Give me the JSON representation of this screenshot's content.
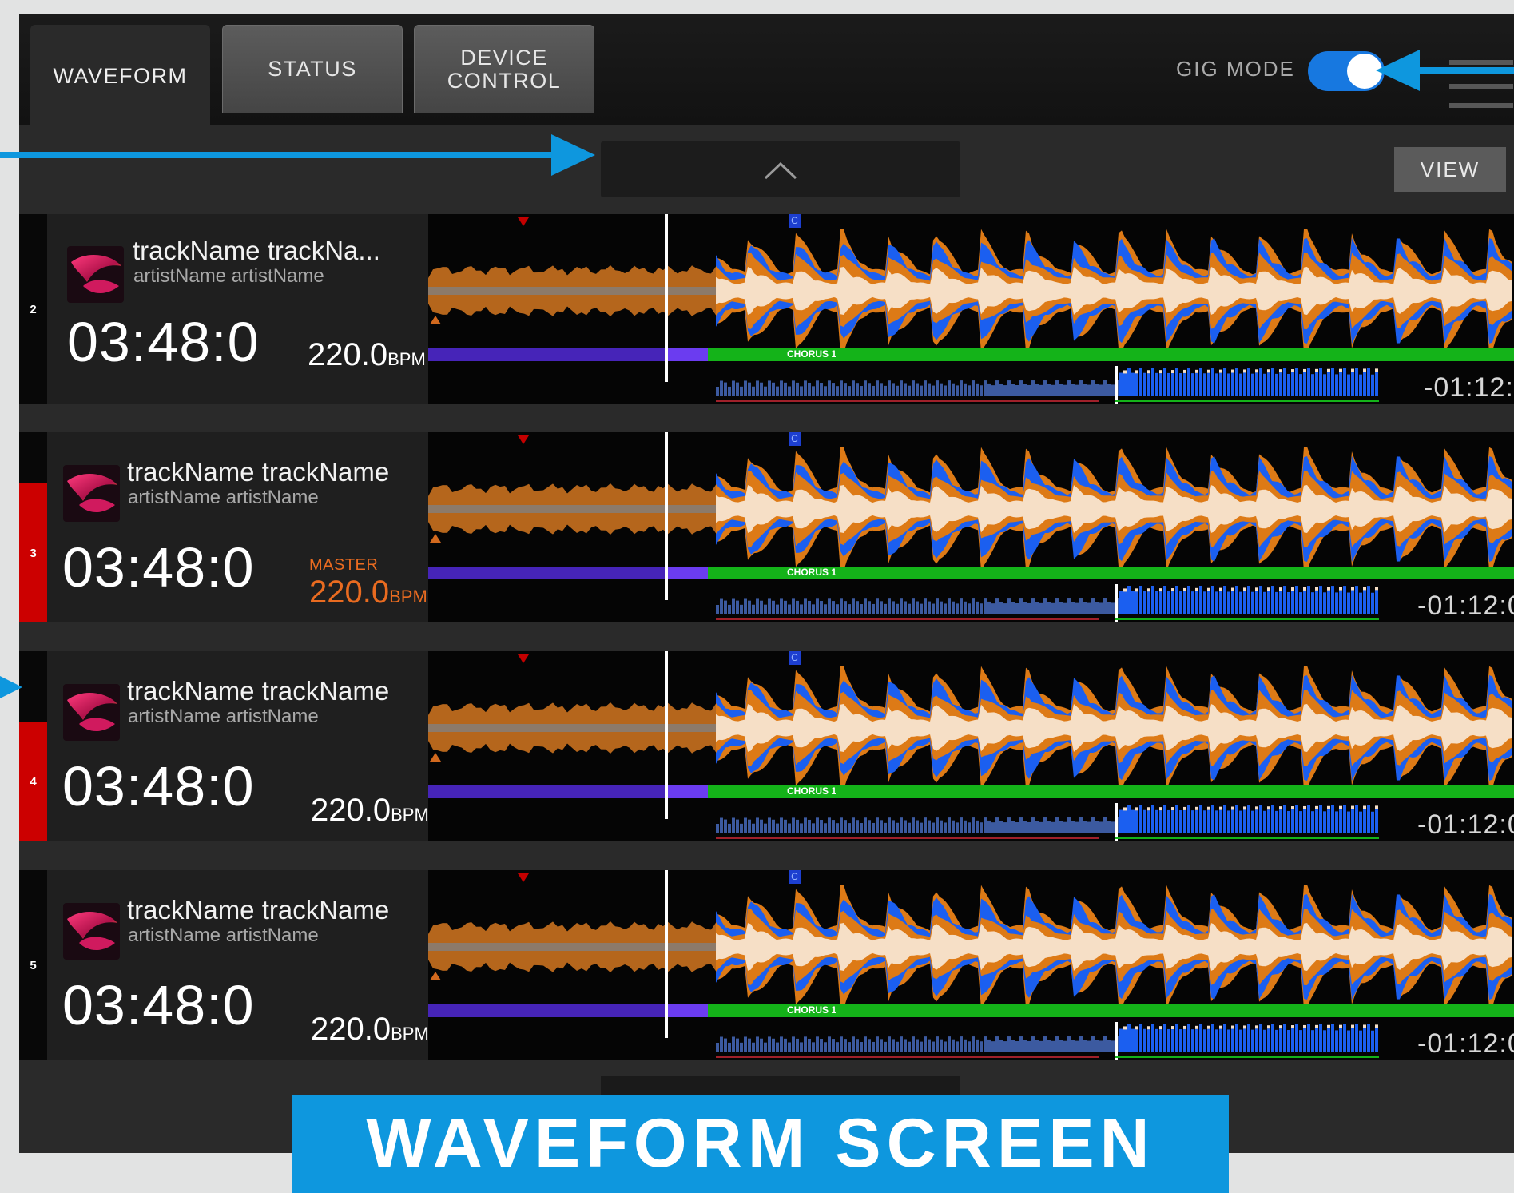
{
  "tabs": [
    {
      "label": "WAVEFORM",
      "active": true
    },
    {
      "label": "STATUS",
      "active": false
    },
    {
      "label": "DEVICE\nCONTROL",
      "active": false
    }
  ],
  "gig_mode": {
    "label": "GIG MODE",
    "on": true
  },
  "view_button": "VIEW",
  "decks": [
    {
      "number": "2",
      "track": "trackName trackNa...",
      "artist": "artistName artistName",
      "time": "03:48:0",
      "bpm": "220.0",
      "bpm_unit": "BPM",
      "master_label": "",
      "remaining": "-01:12:",
      "section_label": "CHORUS 1",
      "cue_label": "C"
    },
    {
      "number": "3",
      "track": "trackName trackName",
      "artist": "artistName artistName",
      "time": "03:48:0",
      "bpm": "220.0",
      "bpm_unit": "BPM",
      "master_label": "MASTER",
      "remaining": "-01:12:0",
      "section_label": "CHORUS 1",
      "cue_label": "C"
    },
    {
      "number": "4",
      "track": "trackName trackName",
      "artist": "artistName artistName",
      "time": "03:48:0",
      "bpm": "220.0",
      "bpm_unit": "BPM",
      "master_label": "",
      "remaining": "-01:12:0",
      "section_label": "CHORUS 1",
      "cue_label": "C"
    },
    {
      "number": "5",
      "track": "trackName trackName",
      "artist": "artistName artistName",
      "time": "03:48:0",
      "bpm": "220.0",
      "bpm_unit": "BPM",
      "master_label": "",
      "remaining": "-01:12:0",
      "section_label": "CHORUS 1",
      "cue_label": "C"
    }
  ],
  "caption": "WAVEFORM SCREEN",
  "colors": {
    "accent": "#1778e0",
    "annotation": "#0e97de",
    "deck_active": "#cc0000",
    "master": "#e96b20",
    "wave_orange": "#dd7a16",
    "wave_blue": "#1b5ff0",
    "wave_cream": "#f6dfc6",
    "section_green": "#14b319",
    "section_purple": "#4624b8"
  }
}
